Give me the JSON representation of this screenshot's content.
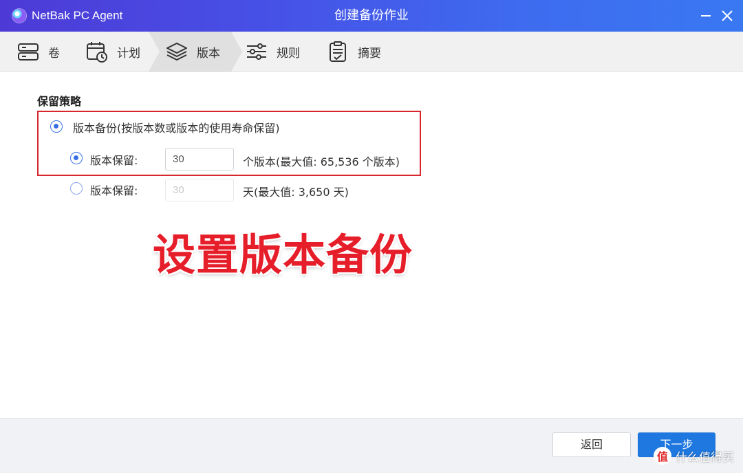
{
  "app": {
    "name": "NetBak PC Agent",
    "window_title": "创建备份作业"
  },
  "steps": [
    {
      "label": "卷",
      "icon": "volume-icon"
    },
    {
      "label": "计划",
      "icon": "calendar-clock-icon"
    },
    {
      "label": "版本",
      "icon": "layers-icon",
      "active": true
    },
    {
      "label": "规则",
      "icon": "sliders-icon"
    },
    {
      "label": "摘要",
      "icon": "clipboard-icon"
    }
  ],
  "retention": {
    "title": "保留策略",
    "option_version_backup": "版本备份(按版本数或版本的使用寿命保留)",
    "by_count": {
      "label": "版本保留:",
      "value": "30",
      "suffix": "个版本(最大值: 65,536 个版本)"
    },
    "by_days": {
      "label": "版本保留:",
      "value": "30",
      "suffix": "天(最大值: 3,650 天)"
    }
  },
  "overlay_caption": "设置版本备份",
  "footer": {
    "back_label": "返回",
    "next_label": "下一步"
  },
  "watermark": {
    "logo_char": "值",
    "text": "什么值得买"
  },
  "colors": {
    "accent": "#1e78e0",
    "highlight": "#d8262e",
    "title_bar_start": "#4d3ad6",
    "title_bar_end": "#3a78f2"
  }
}
